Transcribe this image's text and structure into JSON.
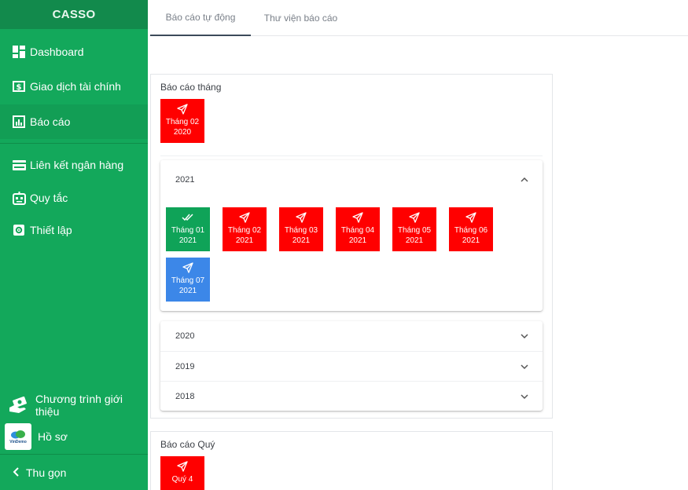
{
  "brand": "CASSO",
  "sidebar": {
    "items": [
      {
        "label": "Dashboard",
        "icon": "dashboard-icon"
      },
      {
        "label": "Giao dịch tài chính",
        "icon": "dollar-receipt-icon"
      },
      {
        "label": "Báo cáo",
        "icon": "bar-chart-icon",
        "active": true
      },
      {
        "label": "Liên kết ngân hàng",
        "icon": "credit-card-icon"
      },
      {
        "label": "Quy tắc",
        "icon": "robot-icon"
      },
      {
        "label": "Thiết lập",
        "icon": "gear-icon"
      }
    ],
    "referral_label": "Chương trình giới thiệu",
    "profile_label": "Hồ sơ",
    "avatar_text": "VinDemo",
    "collapse_label": "Thu gọn"
  },
  "tabs": [
    {
      "label": "Báo cáo tự động",
      "active": true
    },
    {
      "label": "Thư viện báo cáo",
      "active": false
    }
  ],
  "monthly": {
    "title": "Báo cáo tháng",
    "top_card": {
      "line1": "Tháng 02",
      "line2": "2020",
      "status": "sent"
    },
    "expanded_year": "2021",
    "cards": [
      {
        "line1": "Tháng 01",
        "line2": "2021",
        "status": "done"
      },
      {
        "line1": "Tháng 02",
        "line2": "2021",
        "status": "sent"
      },
      {
        "line1": "Tháng 03",
        "line2": "2021",
        "status": "sent"
      },
      {
        "line1": "Tháng 04",
        "line2": "2021",
        "status": "sent"
      },
      {
        "line1": "Tháng 05",
        "line2": "2021",
        "status": "sent"
      },
      {
        "line1": "Tháng 06",
        "line2": "2021",
        "status": "sent"
      },
      {
        "line1": "Tháng 07",
        "line2": "2021",
        "status": "current"
      }
    ],
    "collapsed_years": [
      "2020",
      "2019",
      "2018"
    ]
  },
  "quarterly": {
    "title": "Báo cáo Quý",
    "cards": [
      {
        "line1": "Quý 4",
        "status": "sent"
      }
    ]
  },
  "colors": {
    "sidebar": "#13a85b",
    "sent": "#ff0000",
    "done": "#0fa358",
    "current": "#3c87e8"
  }
}
